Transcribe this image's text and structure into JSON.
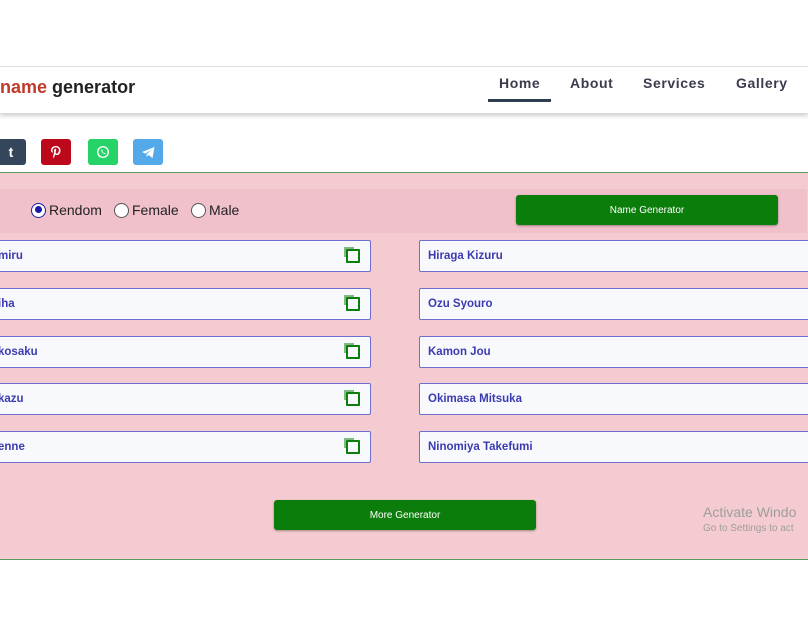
{
  "header": {
    "logo_accent": "name",
    "logo_rest": "generator",
    "nav": [
      {
        "label": "Home",
        "active": true
      },
      {
        "label": "About"
      },
      {
        "label": "Services"
      },
      {
        "label": "Gallery"
      }
    ]
  },
  "share": [
    {
      "name": "tumblr-icon",
      "glyph": "t",
      "color": "#35465c"
    },
    {
      "name": "pinterest-icon",
      "glyph": "P",
      "color": "#bd081c"
    },
    {
      "name": "whatsapp-icon",
      "glyph": "",
      "color": "#25d366"
    },
    {
      "name": "telegram-icon",
      "glyph": "",
      "color": "#54a9eb"
    }
  ],
  "generator": {
    "gender_options": [
      {
        "label": "Rendom",
        "selected": true
      },
      {
        "label": "Female",
        "selected": false
      },
      {
        "label": "Male",
        "selected": false
      }
    ],
    "name_generator_label": "Name Generator",
    "left_names": [
      "miru",
      "iha",
      "kosaku",
      "kazu",
      "enne"
    ],
    "right_names": [
      "Hiraga Kizuru",
      "Ozu Syouro",
      "Kamon Jou",
      "Okimasa Mitsuka",
      "Ninomiya Takefumi"
    ],
    "more_generator_label": "More Generator"
  },
  "watermark": {
    "line1": "Activate Windo",
    "line2": "Go to Settings to act"
  },
  "colors": {
    "panel_bg": "#f4cbd0",
    "button_green": "#0b7d0b",
    "name_text": "#3b3bb0",
    "logo_accent": "#c0392b"
  }
}
